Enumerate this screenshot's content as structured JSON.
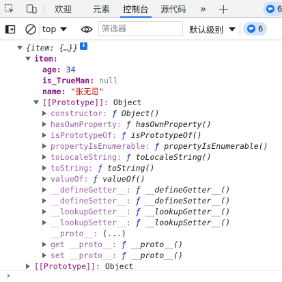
{
  "tabs": {
    "items": [
      {
        "label": "欢迎"
      },
      {
        "label": "元素"
      },
      {
        "label": "控制台"
      },
      {
        "label": "源代码"
      }
    ],
    "more_label": "»",
    "add_label": "+",
    "active": "控制台"
  },
  "toolbar": {
    "context_value": "top",
    "filter_placeholder": "筛选器",
    "filter_value": "",
    "level_label": "默认级别",
    "issues_count": "6",
    "tab_issues_count": "6"
  },
  "console": {
    "root_preview": "{item: {…}}",
    "info_glyph": "i",
    "item_key": "item",
    "props": [
      {
        "key": "age",
        "value": "34",
        "kind": "num"
      },
      {
        "key": "is_TrueMan",
        "value": "null",
        "kind": "null"
      },
      {
        "key": "name",
        "value": "\"张无忌\"",
        "kind": "str"
      }
    ],
    "proto_label": "[[Prototype]]",
    "proto_value": "Object",
    "proto_members": [
      {
        "key": "constructor",
        "fn": "Object()"
      },
      {
        "key": "hasOwnProperty",
        "fn": "hasOwnProperty()"
      },
      {
        "key": "isPrototypeOf",
        "fn": "isPrototypeOf()"
      },
      {
        "key": "propertyIsEnumerable",
        "fn": "propertyIsEnumerable()"
      },
      {
        "key": "toLocaleString",
        "fn": "toLocaleString()"
      },
      {
        "key": "toString",
        "fn": "toString()"
      },
      {
        "key": "valueOf",
        "fn": "valueOf()"
      },
      {
        "key": "__defineGetter__",
        "fn": "__defineGetter__()"
      },
      {
        "key": "__defineSetter__",
        "fn": "__defineSetter__()"
      },
      {
        "key": "__lookupGetter__",
        "fn": "__lookupGetter__()"
      },
      {
        "key": "__lookupSetter__",
        "fn": "__lookupSetter__()"
      }
    ],
    "proto_getter": {
      "key": "__proto__",
      "value": "(...)"
    },
    "accessors": [
      {
        "prefix": "get",
        "key": "__proto__",
        "fn": "__proto__()"
      },
      {
        "prefix": "set",
        "key": "__proto__",
        "fn": "__proto__()"
      }
    ],
    "fn_keyword": "ƒ",
    "outer_proto_label": "[[Prototype]]",
    "outer_proto_value": "Object",
    "prompt_glyph": "›"
  }
}
